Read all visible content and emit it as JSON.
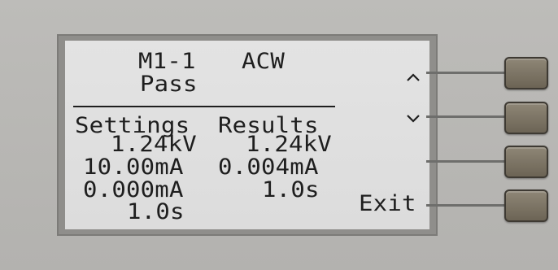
{
  "screen": {
    "header": {
      "memory_step": "M1-1",
      "test_mode": "ACW",
      "status": "Pass"
    },
    "columns": {
      "settings_title": "Settings",
      "results_title": "Results"
    },
    "settings": [
      "1.24kV",
      "10.00mA",
      "0.000mA",
      "1.0s"
    ],
    "results": [
      "1.24kV",
      "0.004mA",
      "1.0s"
    ],
    "softkeys": {
      "up_icon": "caret-up-icon",
      "down_icon": "caret-down-icon",
      "blank": "",
      "exit_label": "Exit"
    }
  },
  "colors": {
    "lcd_background": "#e0e0e0",
    "lcd_text": "#1e1e1e",
    "panel": "#b8b7b4",
    "button": "#7b7364"
  }
}
